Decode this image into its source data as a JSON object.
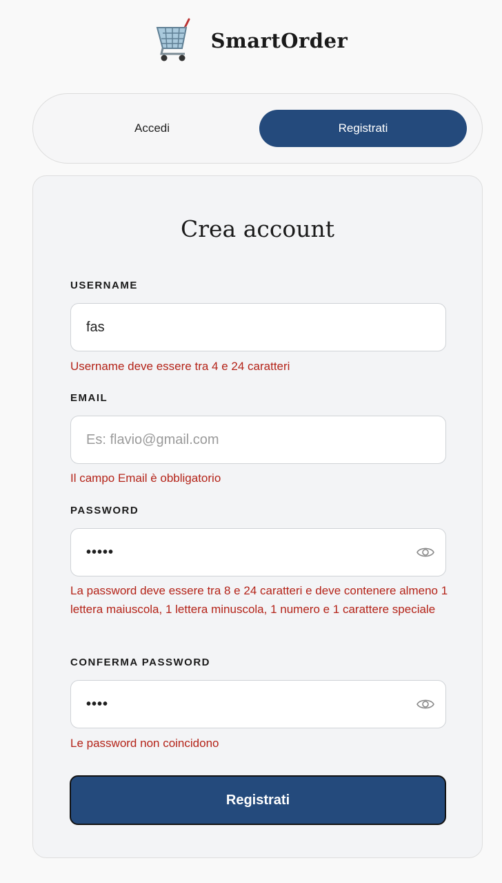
{
  "app": {
    "title": "SmartOrder",
    "logo_icon": "shopping-cart-icon"
  },
  "tabs": {
    "login_label": "Accedi",
    "register_label": "Registrati",
    "active": "register"
  },
  "form": {
    "title": "Crea account",
    "username": {
      "label": "USERNAME",
      "value": "fas",
      "placeholder": "",
      "error": "Username deve essere tra 4 e 24 caratteri"
    },
    "email": {
      "label": "EMAIL",
      "value": "",
      "placeholder": "Es: flavio@gmail.com",
      "error": "Il campo Email è obbligatorio"
    },
    "password": {
      "label": "PASSWORD",
      "value_masked": "•••••",
      "toggle_icon": "eye-icon",
      "error": "La password deve essere tra 8 e 24 caratteri e deve contenere almeno 1 lettera maiuscola, 1 lettera minuscola, 1 numero e 1 carattere speciale"
    },
    "confirm_password": {
      "label": "CONFERMA PASSWORD",
      "value_masked": "••••",
      "toggle_icon": "eye-icon",
      "error": "Le password non coincidono"
    },
    "submit_label": "Registrati"
  },
  "colors": {
    "primary": "#244a7c",
    "error": "#b42318",
    "background": "#f9f9f9",
    "card_background": "#f3f4f6"
  }
}
